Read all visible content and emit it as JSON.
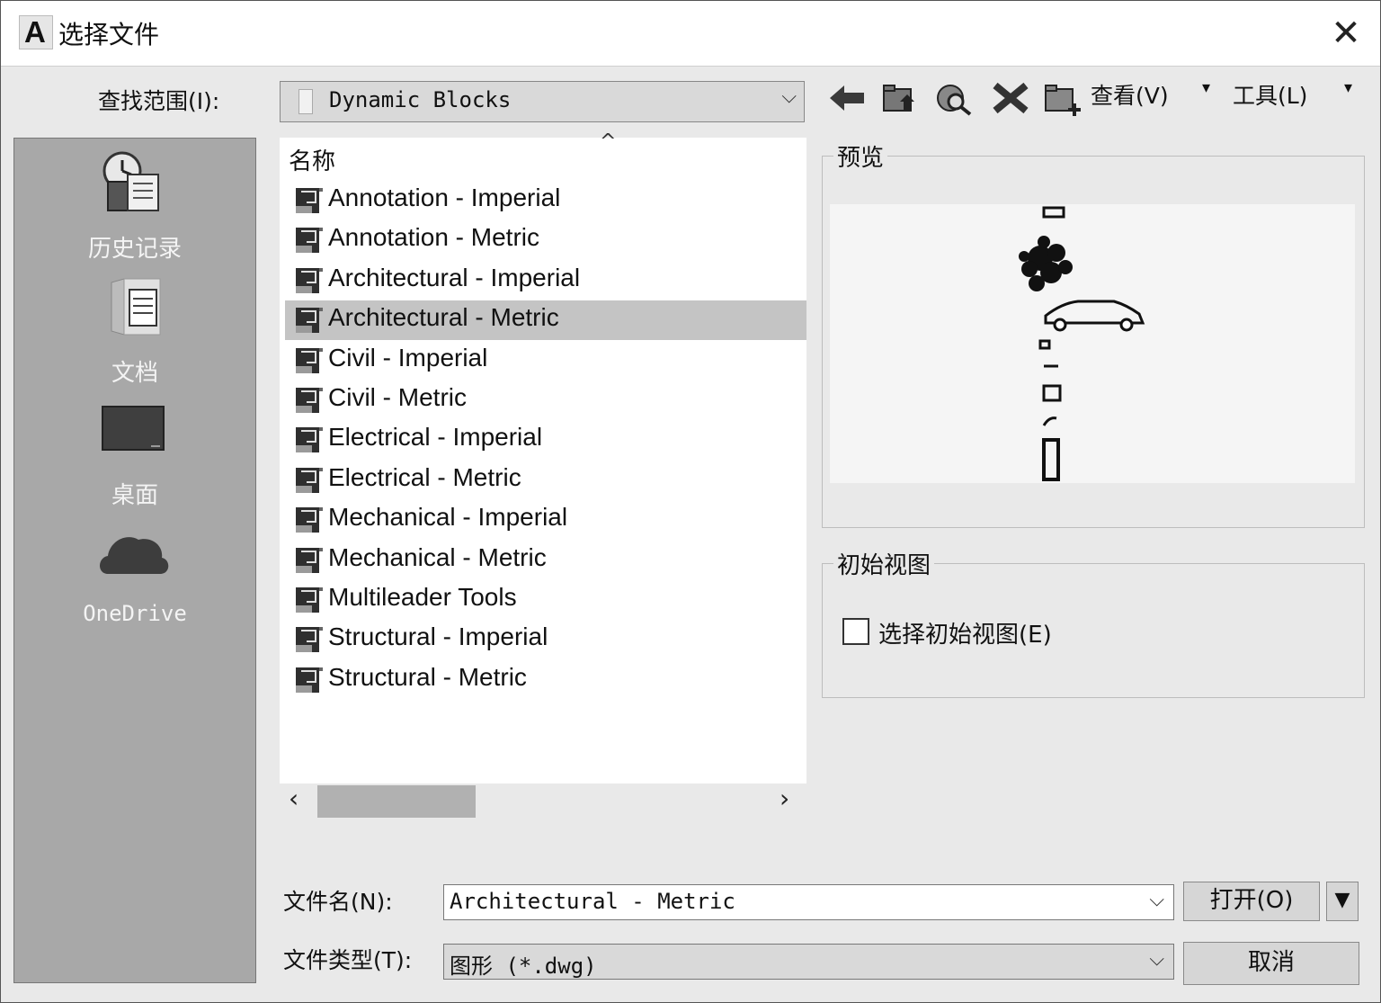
{
  "window": {
    "title": "选择文件",
    "close_symbol": "✕",
    "app_icon_letter": "A"
  },
  "lookin": {
    "label": "查找范围(I):",
    "value": "Dynamic Blocks"
  },
  "toolbar": {
    "icons": [
      "back-arrow-icon",
      "up-folder-icon",
      "search-web-icon",
      "delete-icon",
      "new-folder-icon"
    ],
    "view_label": "查看(V)",
    "tools_label": "工具(L)"
  },
  "places": [
    {
      "label": "历史记录",
      "icon": "history-icon"
    },
    {
      "label": "文档",
      "icon": "documents-icon"
    },
    {
      "label": "桌面",
      "icon": "desktop-icon"
    },
    {
      "label": "OneDrive",
      "icon": "cloud-icon"
    }
  ],
  "filelist": {
    "header": "名称",
    "items": [
      "Annotation - Imperial",
      "Annotation - Metric",
      "Architectural - Imperial",
      "Architectural - Metric",
      "Civil - Imperial",
      "Civil - Metric",
      "Electrical - Imperial",
      "Electrical - Metric",
      "Mechanical - Imperial",
      "Mechanical - Metric",
      "Multileader Tools",
      "Structural - Imperial",
      "Structural - Metric"
    ],
    "selected_index": 3
  },
  "preview": {
    "title": "预览"
  },
  "initial_view": {
    "title": "初始视图",
    "checkbox_label": "选择初始视图(E)",
    "checked": false
  },
  "filename": {
    "label": "文件名(N):",
    "value": "Architectural - Metric"
  },
  "filetype": {
    "label": "文件类型(T):",
    "value": "图形 (*.dwg)"
  },
  "buttons": {
    "open": "打开(O)",
    "cancel": "取消"
  },
  "colors": {
    "selection": "#c4c4c4",
    "places_bg": "#a8a8a8",
    "dialog_bg": "#e9e9e9"
  }
}
